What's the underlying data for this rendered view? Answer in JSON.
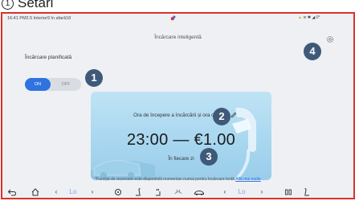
{
  "caption": {
    "number": "1",
    "text": "Setări"
  },
  "status_bar": {
    "left_text": "16:41 PM2.5 Interior9 în afară18",
    "right_text": "≋ ✱ ◢ 0°"
  },
  "page": {
    "title": "Încărcare inteligentă"
  },
  "scheduled_charging": {
    "label": "Încărcare planificată",
    "on_label": "ON",
    "off_label": "OFF",
    "state": "on"
  },
  "card": {
    "heading": "Ora de începere a încărcării și ora de inchi",
    "time_text": "23:00  —  €1.00",
    "frequency": "În fiecare zi"
  },
  "footnote": {
    "text": "*Funcția de rezervare este disponibilă momentan numai pentru încărcare lentă ",
    "link": "Află mai multe"
  },
  "badges": [
    "1",
    "2",
    "3",
    "4"
  ],
  "nav_bar": {
    "left_temp": "Lo",
    "right_temp": "Lo"
  },
  "colors": {
    "accent": "#2f72e0",
    "badge": "#3f5a78",
    "frame": "#d9312b"
  }
}
